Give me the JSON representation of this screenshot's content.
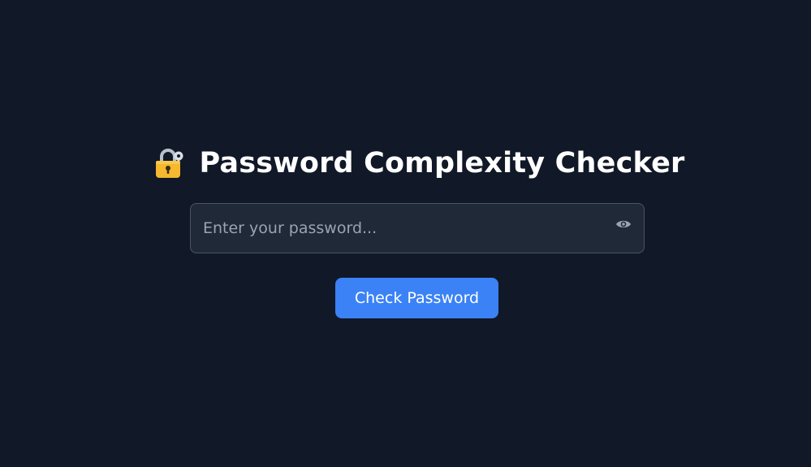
{
  "header": {
    "title": "Password Complexity Checker",
    "icon": "lock-with-key-icon"
  },
  "password": {
    "placeholder": "Enter your password...",
    "value": "",
    "toggle_icon": "eye-icon"
  },
  "actions": {
    "check_label": "Check Password"
  },
  "colors": {
    "background": "#111827",
    "input_background": "#1f2937",
    "input_border": "#4b5563",
    "accent": "#3b82f6",
    "title": "#ffffff",
    "icon_lock": "#f5b82e"
  }
}
